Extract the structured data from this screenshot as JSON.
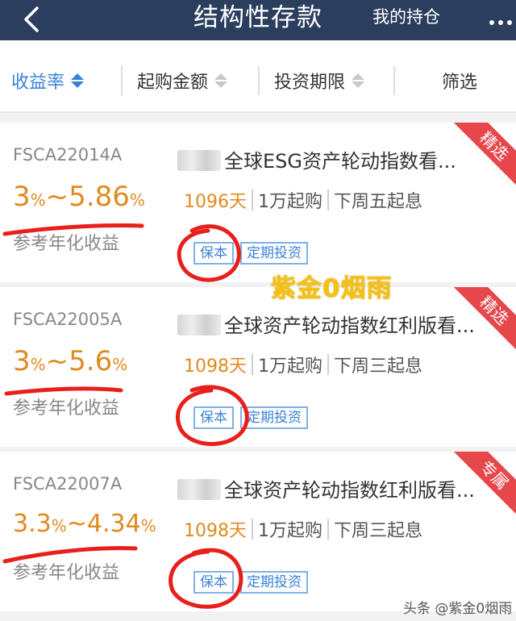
{
  "header": {
    "title": "结构性存款",
    "holdings_label": "我的持仓",
    "back_icon": "chevron-left-icon",
    "more_icon": "more-dots-icon",
    "bg_color": "#2c3e5e"
  },
  "filters": [
    {
      "label": "收益率",
      "active": true
    },
    {
      "label": "起购金额",
      "active": false
    },
    {
      "label": "投资期限",
      "active": false
    },
    {
      "label": "筛选",
      "active": false
    }
  ],
  "products": [
    {
      "code": "FSCA22014A",
      "rate_low": "3",
      "rate_high": "5.86",
      "pct": "%",
      "tilde": "~",
      "rate_label": "参考年化收益",
      "name": "全球ESG资产轮动指数看...",
      "days": "1096天",
      "min_amount": "1万起购",
      "start": "下周五起息",
      "tag1": "保本",
      "tag2": "定期投资",
      "corner": "精选"
    },
    {
      "code": "FSCA22005A",
      "rate_low": "3",
      "rate_high": "5.6",
      "pct": "%",
      "tilde": "~",
      "rate_label": "参考年化收益",
      "name": "全球资产轮动指数红利版看...",
      "days": "1098天",
      "min_amount": "1万起购",
      "start": "下周三起息",
      "tag1": "保本",
      "tag2": "定期投资",
      "corner": "精选"
    },
    {
      "code": "FSCA22007A",
      "rate_low": "3.3",
      "rate_high": "4.34",
      "pct": "%",
      "tilde": "~",
      "rate_label": "参考年化收益",
      "name": "全球资产轮动指数红利版看...",
      "days": "1098天",
      "min_amount": "1万起购",
      "start": "下周三起息",
      "tag1": "保本",
      "tag2": "定期投资",
      "corner": "专属"
    }
  ],
  "overlay_text": "紫金0烟雨",
  "watermark": "头条 @紫金0烟雨",
  "colors": {
    "accent": "#3a82d6",
    "rate": "#e08a1e",
    "annotation": "#e8201c"
  }
}
